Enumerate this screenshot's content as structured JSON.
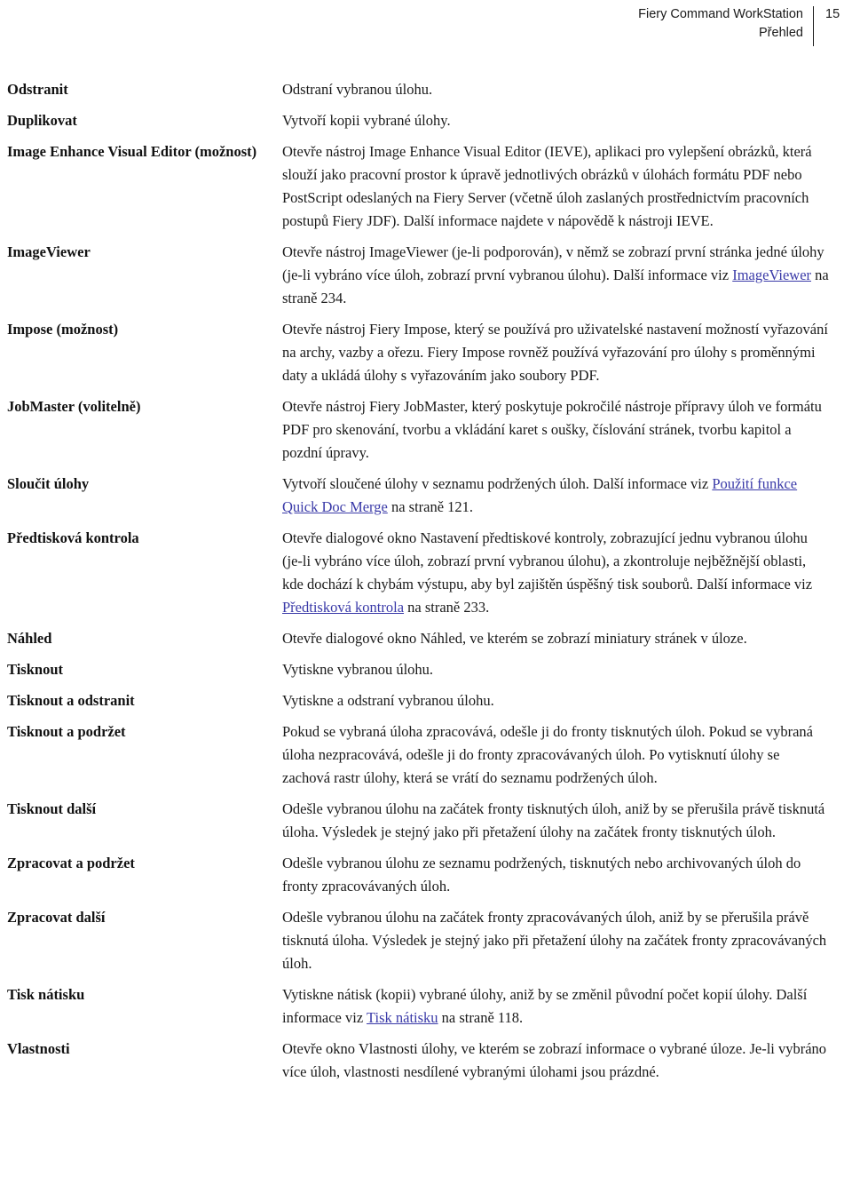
{
  "header": {
    "product_title": "Fiery Command WorkStation",
    "section_title": "Přehled",
    "page_number": "15"
  },
  "entries": [
    {
      "term": "Odstranit",
      "description": "Odstraní vybranou úlohu."
    },
    {
      "term": "Duplikovat",
      "description": "Vytvoří kopii vybrané úlohy."
    },
    {
      "term": "Image Enhance Visual Editor (možnost)",
      "description": "Otevře nástroj Image Enhance Visual Editor (IEVE), aplikaci pro vylepšení obrázků, která slouží jako pracovní prostor k úpravě jednotlivých obrázků v úlohách formátu PDF nebo PostScript odeslaných na Fiery Server (včetně úloh zaslaných prostřednictvím pracovních postupů Fiery JDF). Další informace najdete v nápovědě k nástroji IEVE."
    },
    {
      "term": "ImageViewer",
      "description_before": "Otevře nástroj ImageViewer (je-li podporován), v němž se zobrazí první stránka jedné úlohy (je-li vybráno více úloh, zobrazí první vybranou úlohu). Další informace viz ",
      "link_text": "ImageViewer",
      "description_after": " na straně 234."
    },
    {
      "term": "Impose (možnost)",
      "description": "Otevře nástroj Fiery Impose, který se používá pro uživatelské nastavení možností vyřazování na archy, vazby a ořezu. Fiery Impose rovněž používá vyřazování pro úlohy s proměnnými daty a ukládá úlohy s vyřazováním jako soubory PDF."
    },
    {
      "term": "JobMaster (volitelně)",
      "description": "Otevře nástroj Fiery JobMaster, který poskytuje pokročilé nástroje přípravy úloh ve formátu PDF pro skenování, tvorbu a vkládání karet s oušky, číslování stránek, tvorbu kapitol a pozdní úpravy."
    },
    {
      "term": "Sloučit úlohy",
      "description_before": "Vytvoří sloučené úlohy v seznamu podržených úloh. Další informace viz ",
      "link_text": "Použití funkce Quick Doc Merge",
      "description_after": " na straně 121."
    },
    {
      "term": "Předtisková kontrola",
      "description_before": "Otevře dialogové okno Nastavení předtiskové kontroly, zobrazující jednu vybranou úlohu (je-li vybráno více úloh, zobrazí první vybranou úlohu), a zkontroluje nejběžnější oblasti, kde dochází k chybám výstupu, aby byl zajištěn úspěšný tisk souborů. Další informace viz ",
      "link_text": "Předtisková kontrola",
      "description_after": " na straně 233."
    },
    {
      "term": "Náhled",
      "description": "Otevře dialogové okno Náhled, ve kterém se zobrazí miniatury stránek v úloze."
    },
    {
      "term": "Tisknout",
      "description": "Vytiskne vybranou úlohu."
    },
    {
      "term": "Tisknout a odstranit",
      "description": "Vytiskne a odstraní vybranou úlohu."
    },
    {
      "term": "Tisknout a podržet",
      "description": "Pokud se vybraná úloha zpracovává, odešle ji do fronty tisknutých úloh. Pokud se vybraná úloha nezpracovává, odešle ji do fronty zpracovávaných úloh. Po vytisknutí úlohy se zachová rastr úlohy, která se vrátí do seznamu podržených úloh."
    },
    {
      "term": "Tisknout další",
      "description": "Odešle vybranou úlohu na začátek fronty tisknutých úloh, aniž by se přerušila právě tisknutá úloha. Výsledek je stejný jako při přetažení úlohy na začátek fronty tisknutých úloh."
    },
    {
      "term": "Zpracovat a podržet",
      "description": "Odešle vybranou úlohu ze seznamu podržených, tisknutých nebo archivovaných úloh do fronty zpracovávaných úloh."
    },
    {
      "term": "Zpracovat další",
      "description": "Odešle vybranou úlohu na začátek fronty zpracovávaných úloh, aniž by se přerušila právě tisknutá úloha. Výsledek je stejný jako při přetažení úlohy na začátek fronty zpracovávaných úloh."
    },
    {
      "term": "Tisk nátisku",
      "description_before": "Vytiskne nátisk (kopii) vybrané úlohy, aniž by se změnil původní počet kopií úlohy. Další informace viz ",
      "link_text": "Tisk nátisku",
      "description_after": " na straně 118."
    },
    {
      "term": "Vlastnosti",
      "description": "Otevře okno Vlastnosti úlohy, ve kterém se zobrazí informace o vybrané úloze. Je-li vybráno více úloh, vlastnosti nesdílené vybranými úlohami jsou prázdné."
    }
  ],
  "colors": {
    "link": "#3a3aa8",
    "text": "#1a1a1a",
    "background": "#ffffff"
  }
}
